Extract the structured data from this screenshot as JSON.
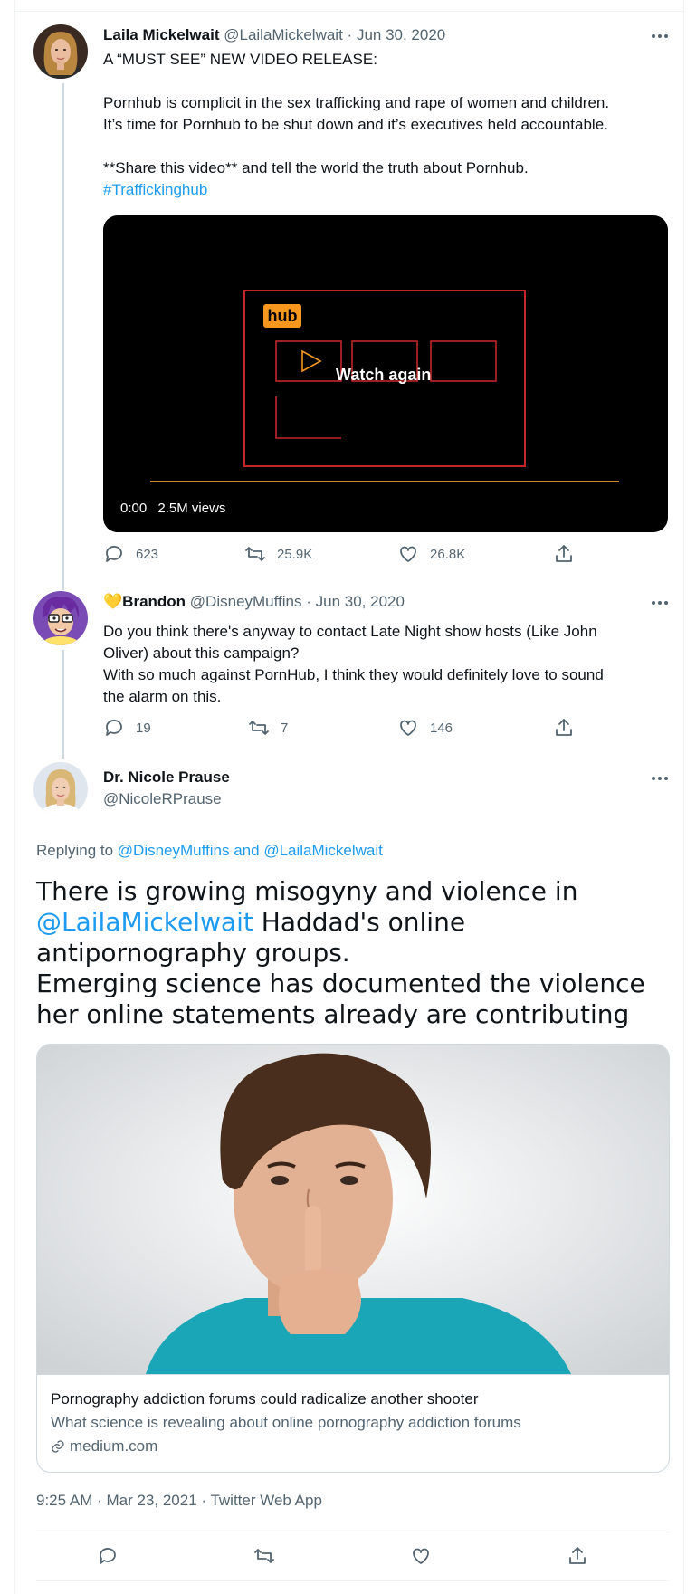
{
  "tweet1": {
    "author_name": "Laila Mickelwait",
    "author_handle": "@LailaMickelwait",
    "date": "Jun 30, 2020",
    "line1": "A “MUST SEE” NEW VIDEO RELEASE:",
    "line2": "Pornhub is complicit in the sex trafficking and rape of women and children.\nIt’s time for Pornhub to be shut down and it’s executives held accountable.",
    "line3": "**Share this video** and tell the world the truth about Pornhub.",
    "hashtag": "#Traffickinghub",
    "video": {
      "logo_text": "hub",
      "overlay": "Watch again",
      "time": "0:00",
      "views": "2.5M views"
    },
    "replies": "623",
    "retweets": "25.9K",
    "likes": "26.8K"
  },
  "tweet2": {
    "author_name": "Brandon",
    "author_emoji": "💛",
    "author_handle": "@DisneyMuffins",
    "date": "Jun 30, 2020",
    "text": "Do you think there's anyway to contact Late Night show hosts (Like John\nOliver) about this campaign?\nWith so much against PornHub, I think they would definitely love to sound\nthe alarm on this.",
    "replies": "19",
    "retweets": "7",
    "likes": "146"
  },
  "tweet3": {
    "author_name": "Dr. Nicole Prause",
    "author_handle": "@NicoleRPrause",
    "replying_prefix": "Replying to ",
    "replying_user1": "@DisneyMuffins",
    "replying_and": " and ",
    "replying_user2": "@LailaMickelwait",
    "text_before": "There is growing misogyny and violence in ",
    "mention": "@LailaMickelwait",
    "text_after": " Haddad's online antipornography groups.\nEmerging science has documented the violence her online statements already are contributing",
    "card": {
      "title": "Pornography addiction forums could radicalize another shooter",
      "description": "What science is revealing about online pornography addiction forums",
      "domain": "medium.com"
    },
    "timestamp": "9:25 AM · Mar 23, 2021 · Twitter Web App"
  },
  "colors": {
    "link": "#1d9bf0",
    "secondary": "#536471",
    "pornhub_orange": "#f7971e"
  }
}
